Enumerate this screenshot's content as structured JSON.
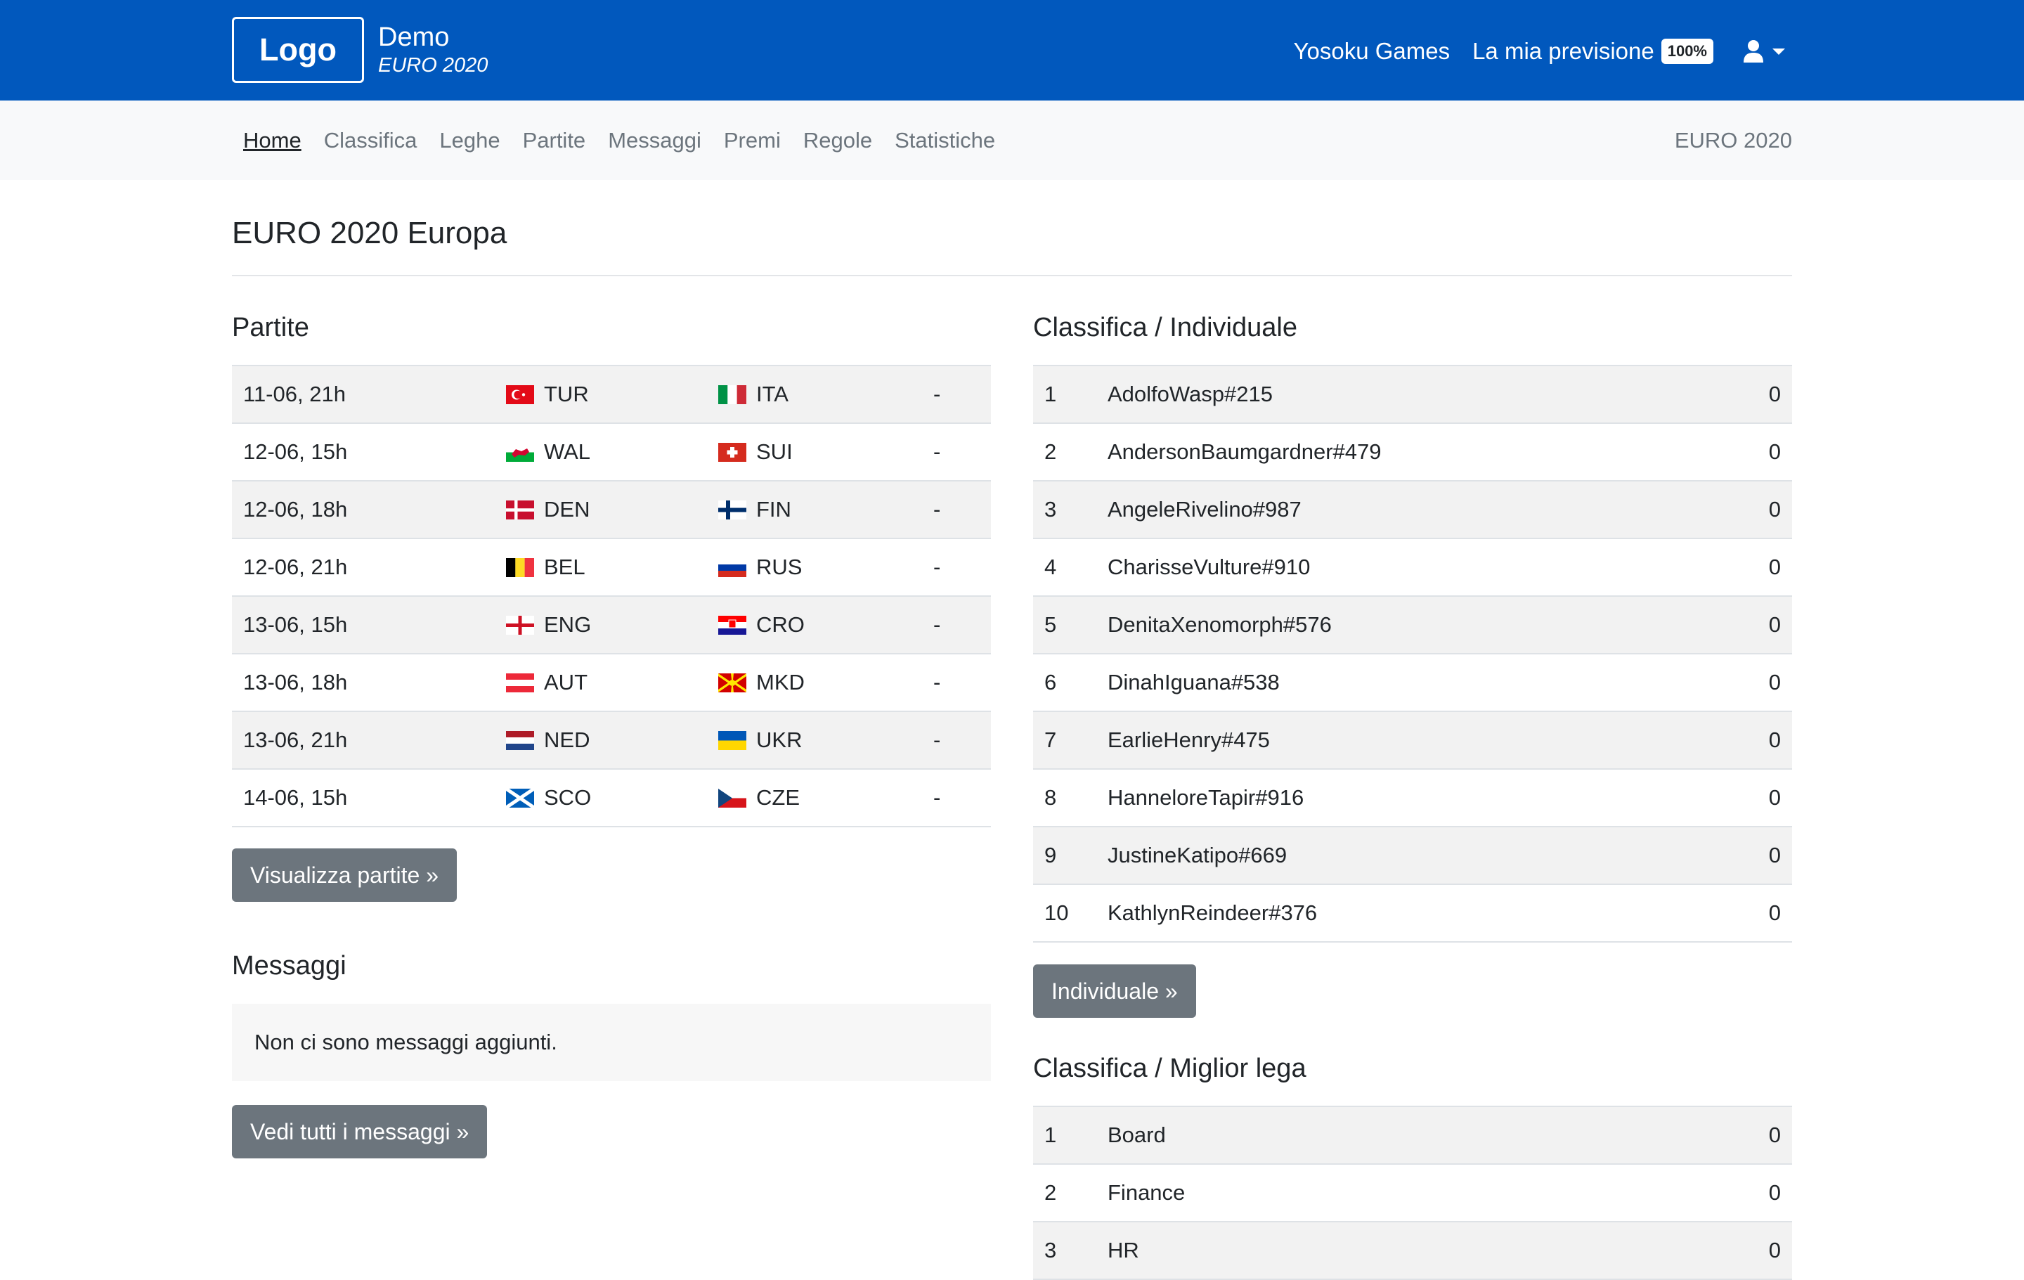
{
  "header": {
    "logo": "Logo",
    "brand_title": "Demo",
    "brand_subtitle": "EURO 2020",
    "nav_games": "Yosoku Games",
    "nav_forecast": "La mia previsione",
    "forecast_badge": "100%",
    "user_icon": "user-icon"
  },
  "subnav": {
    "items": [
      "Home",
      "Classifica",
      "Leghe",
      "Partite",
      "Messaggi",
      "Premi",
      "Regole",
      "Statistiche"
    ],
    "active": "Home",
    "right": "EURO 2020"
  },
  "page": {
    "title": "EURO 2020 Europa"
  },
  "matches": {
    "title": "Partite",
    "rows": [
      {
        "date": "11-06, 21h",
        "home": "TUR",
        "away": "ITA",
        "score": "-"
      },
      {
        "date": "12-06, 15h",
        "home": "WAL",
        "away": "SUI",
        "score": "-"
      },
      {
        "date": "12-06, 18h",
        "home": "DEN",
        "away": "FIN",
        "score": "-"
      },
      {
        "date": "12-06, 21h",
        "home": "BEL",
        "away": "RUS",
        "score": "-"
      },
      {
        "date": "13-06, 15h",
        "home": "ENG",
        "away": "CRO",
        "score": "-"
      },
      {
        "date": "13-06, 18h",
        "home": "AUT",
        "away": "MKD",
        "score": "-"
      },
      {
        "date": "13-06, 21h",
        "home": "NED",
        "away": "UKR",
        "score": "-"
      },
      {
        "date": "14-06, 15h",
        "home": "SCO",
        "away": "CZE",
        "score": "-"
      }
    ],
    "button": "Visualizza partite »"
  },
  "messages": {
    "title": "Messaggi",
    "empty": "Non ci sono messaggi aggiunti.",
    "button": "Vedi tutti i messaggi »"
  },
  "ranking_individual": {
    "title": "Classifica / Individuale",
    "rows": [
      {
        "rank": "1",
        "name": "AdolfoWasp#215",
        "points": "0"
      },
      {
        "rank": "2",
        "name": "AndersonBaumgardner#479",
        "points": "0"
      },
      {
        "rank": "3",
        "name": "AngeleRivelino#987",
        "points": "0"
      },
      {
        "rank": "4",
        "name": "CharisseVulture#910",
        "points": "0"
      },
      {
        "rank": "5",
        "name": "DenitaXenomorph#576",
        "points": "0"
      },
      {
        "rank": "6",
        "name": "DinahIguana#538",
        "points": "0"
      },
      {
        "rank": "7",
        "name": "EarlieHenry#475",
        "points": "0"
      },
      {
        "rank": "8",
        "name": "HanneloreTapir#916",
        "points": "0"
      },
      {
        "rank": "9",
        "name": "JustineKatipo#669",
        "points": "0"
      },
      {
        "rank": "10",
        "name": "KathlynReindeer#376",
        "points": "0"
      }
    ],
    "button": "Individuale »"
  },
  "ranking_league": {
    "title": "Classifica / Miglior lega",
    "rows": [
      {
        "rank": "1",
        "name": "Board",
        "points": "0"
      },
      {
        "rank": "2",
        "name": "Finance",
        "points": "0"
      },
      {
        "rank": "3",
        "name": "HR",
        "points": "0"
      }
    ]
  },
  "colors": {
    "primary": "#0158bd",
    "secondary_btn": "#6c757d",
    "subnav_bg": "#f8f9fa"
  }
}
